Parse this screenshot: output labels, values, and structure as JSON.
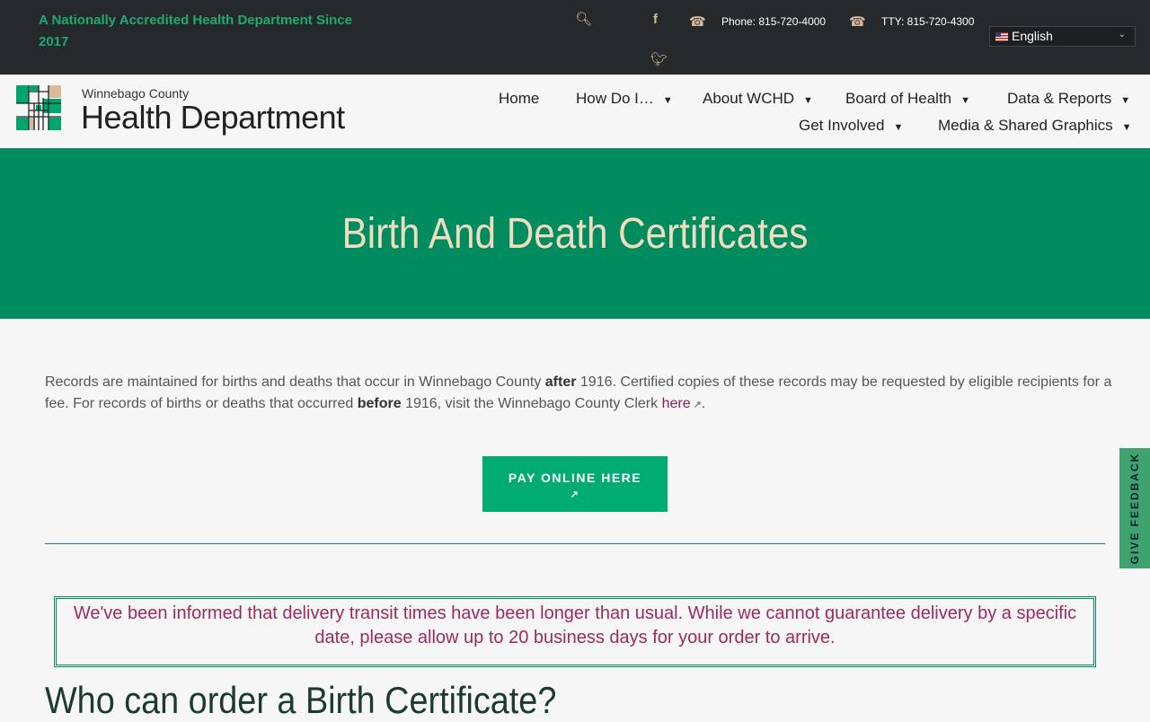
{
  "topbar": {
    "accreditation": "A Nationally Accredited Health Department Since 2017",
    "phone": "Phone: 815-720-4000",
    "tty": "TTY: 815-720-4300",
    "language": "English"
  },
  "logo": {
    "small": "Winnebago County",
    "big": "Health Department"
  },
  "nav": {
    "items": [
      "Home",
      "How Do I…",
      "About WCHD",
      "Board of Health",
      "Data & Reports",
      "Get Involved",
      "Media & Shared Graphics"
    ]
  },
  "hero": {
    "title": "Birth And Death Certificates"
  },
  "intro": {
    "p1": "Records are maintained for births and deaths that occur in Winnebago County ",
    "b1": "after",
    "p2": " 1916. Certified copies of these records may be requested by eligible recipients for a fee. For records of births or deaths that occurred ",
    "b2": "before",
    "p3": " 1916, visit the Winnebago County Clerk ",
    "link": "here",
    "p4": "."
  },
  "pay_button": "PAY ONLINE HERE",
  "notice": "We've been informed that delivery transit times have been longer than usual. While we cannot guarantee delivery by a specific date, please allow up to 20 business days for your order to arrive.",
  "section_heading": "Who can order a Birth Certificate?",
  "feedback": "GIVE FEEDBACK",
  "colors": {
    "brand_green": "#008c5f",
    "button_green": "#00ac71",
    "notice_text": "#9b2a5e",
    "topbar": "#26292b"
  }
}
